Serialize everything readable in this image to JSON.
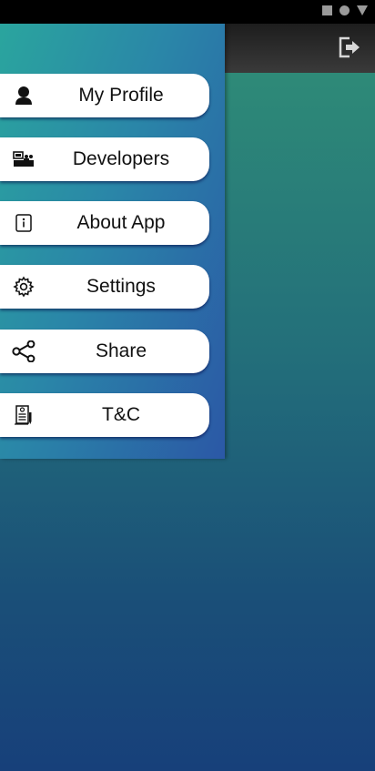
{
  "app_bar": {
    "logout_icon": "logout-icon"
  },
  "menu": [
    {
      "label": "My Profile",
      "icon": "person-icon"
    },
    {
      "label": "Developers",
      "icon": "developers-icon"
    },
    {
      "label": "About App",
      "icon": "info-icon"
    },
    {
      "label": "Settings",
      "icon": "gear-icon"
    },
    {
      "label": "Share",
      "icon": "share-icon"
    },
    {
      "label": "T&C",
      "icon": "document-icon"
    }
  ],
  "colors": {
    "drawer_start": "#2aa59e",
    "drawer_end": "#2b58a6",
    "content_top": "#2e8a78",
    "content_bottom": "#17407a"
  }
}
